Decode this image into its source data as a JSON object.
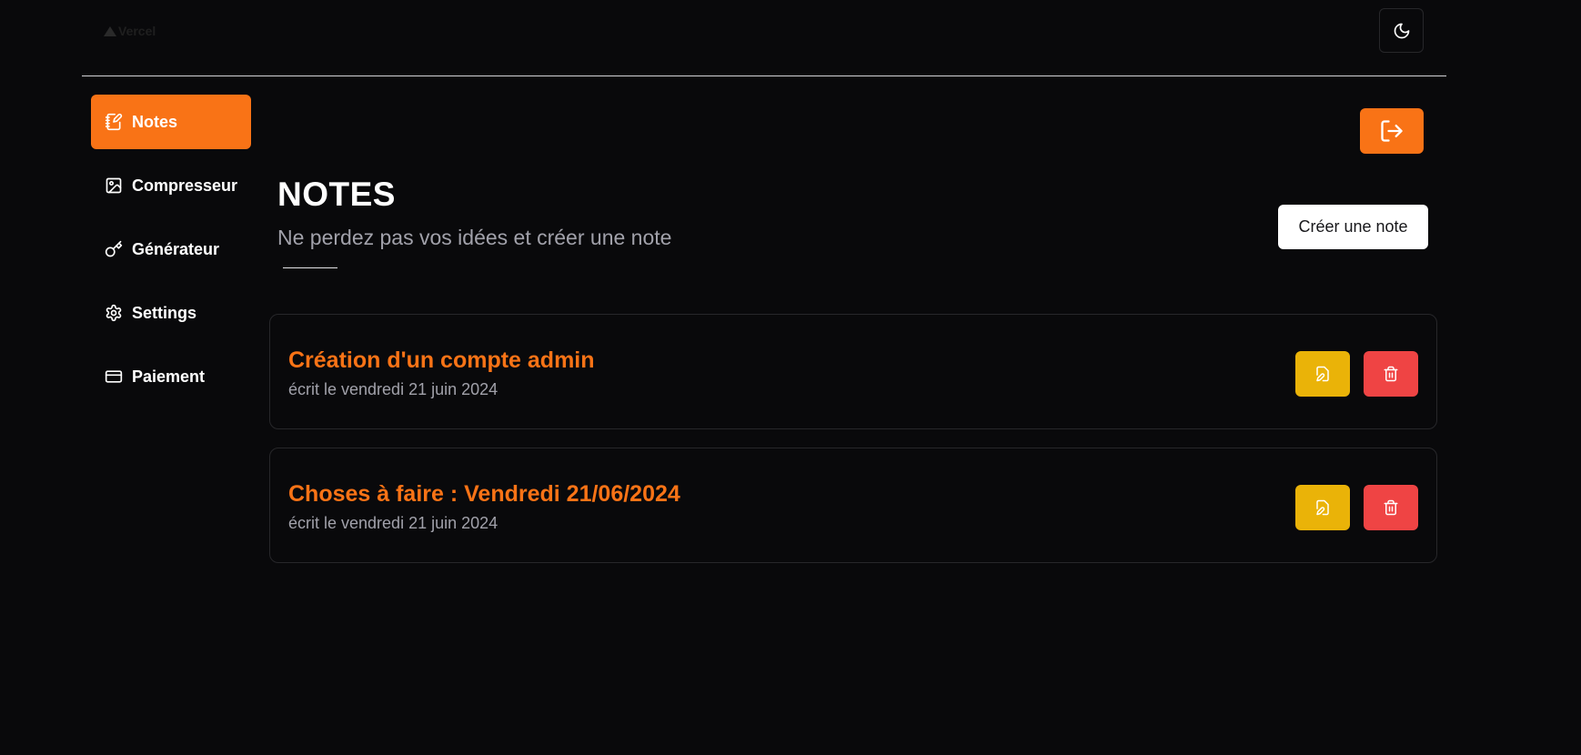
{
  "header": {
    "logo_text": "Vercel",
    "theme_toggle_icon": "moon-icon"
  },
  "sidebar": {
    "items": [
      {
        "label": "Notes",
        "icon": "notebook-pen-icon",
        "active": true
      },
      {
        "label": "Compresseur",
        "icon": "image-icon",
        "active": false
      },
      {
        "label": "Générateur",
        "icon": "key-icon",
        "active": false
      },
      {
        "label": "Settings",
        "icon": "gear-icon",
        "active": false
      },
      {
        "label": "Paiement",
        "icon": "credit-card-icon",
        "active": false
      }
    ]
  },
  "main": {
    "title": "NOTES",
    "subtitle": "Ne perdez pas vos idées et créer une note",
    "create_label": "Créer une note",
    "logout_icon": "log-out-icon",
    "notes": [
      {
        "title": "Création d'un compte admin",
        "date": "écrit le vendredi 21 juin 2024"
      },
      {
        "title": "Choses à faire : Vendredi 21/06/2024",
        "date": "écrit le vendredi 21 juin 2024"
      }
    ]
  },
  "colors": {
    "background": "#09090b",
    "accent": "#f97316",
    "edit": "#eab308",
    "delete": "#ef4444"
  }
}
